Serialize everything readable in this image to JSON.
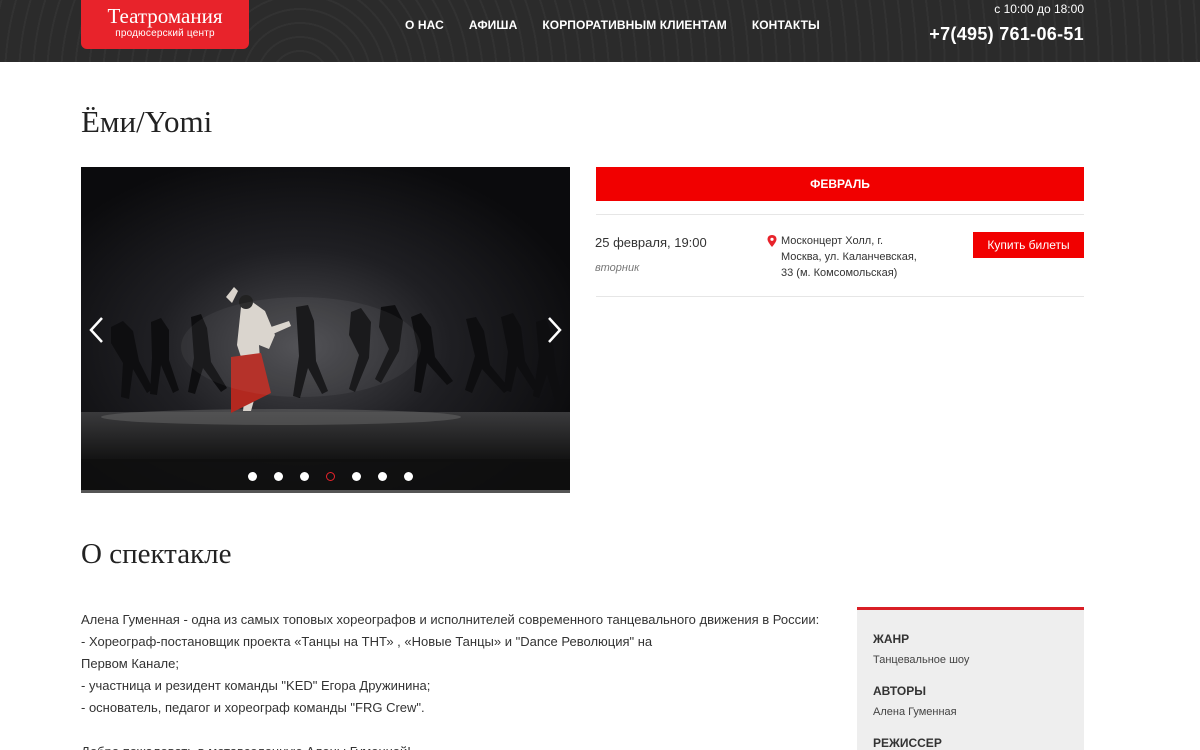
{
  "header": {
    "logo_title": "Театромания",
    "logo_subtitle": "продюсерский центр",
    "nav": [
      "О НАС",
      "АФИША",
      "КОРПОРАТИВНЫМ КЛИЕНТАМ",
      "КОНТАКТЫ"
    ],
    "hours": "с 10:00 до 18:00",
    "phone": "+7(495) 761-06-51"
  },
  "page_title": "Ёми/Yomi",
  "slider": {
    "dot_count": 7,
    "active_dot": 3
  },
  "schedule": {
    "month": "ФЕВРАЛЬ",
    "event": {
      "date": "25 февраля, 19:00",
      "weekday": "вторник",
      "venue_lines": [
        "Москонцерт Холл, г.",
        "Москва, ул. Каланчевская,",
        "33 (м. Комсомольская)"
      ],
      "buy_label": "Купить билеты"
    }
  },
  "about": {
    "title": "О спектакле",
    "lines": [
      "Алена Гуменная - одна из самых топовых хореографов и исполнителей современного танцевального движения в России:",
      "- Хореограф-постановщик проекта «Танцы на ТНТ» , «Новые Танцы» и \"Dance Революция\" на",
      "Первом Канале;",
      "- участница и резидент команды \"KED\" Егора Дружинина;",
      "- основатель, педагог и хореограф команды \"FRG Crew\".",
      "",
      "Добро пожаловать в метавселенную Алены Гуменной!"
    ]
  },
  "info": {
    "genre_label": "ЖАНР",
    "genre_value": "Танцевальное шоу",
    "authors_label": "АВТОРЫ",
    "authors_value": "Алена Гуменная",
    "director_label": "РЕЖИССЕР"
  },
  "colors": {
    "accent": "#f10000",
    "header_bg": "#2b2b2b",
    "logo_bg": "#e8232b"
  }
}
